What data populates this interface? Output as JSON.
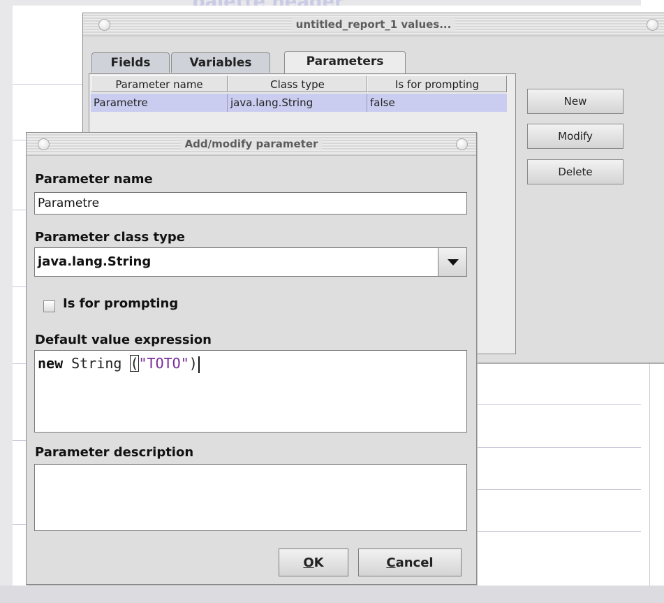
{
  "background": {
    "faded_title": "palette header"
  },
  "values_window": {
    "title": "untitled_report_1 values...",
    "tabs": [
      {
        "label": "Fields",
        "active": false
      },
      {
        "label": "Variables",
        "active": false
      },
      {
        "label": "Parameters",
        "active": true
      }
    ],
    "table": {
      "columns": [
        "Parameter name",
        "Class type",
        "Is for prompting"
      ],
      "rows": [
        [
          "Parametre",
          "java.lang.String",
          "false"
        ]
      ]
    },
    "buttons": {
      "new": "New",
      "modify": "Modify",
      "delete": "Delete"
    }
  },
  "param_dialog": {
    "title": "Add/modify parameter",
    "name_label": "Parameter name",
    "name_value": "Parametre",
    "class_label": "Parameter class type",
    "class_value": "java.lang.String",
    "prompting_label": "Is for prompting",
    "prompting_checked": false,
    "default_label": "Default value expression",
    "default_expression": {
      "keyword": "new",
      "type": " String ",
      "open_paren": "(",
      "string": "\"TOTO\"",
      "close_paren": ")"
    },
    "description_label": "Parameter description",
    "description_value": "",
    "ok_mnemonic": "O",
    "ok_rest": "K",
    "cancel_mnemonic": "C",
    "cancel_rest": "ancel"
  },
  "colors": {
    "selection_row": "#cbcdf0",
    "string_literal": "#7a2c9a"
  }
}
